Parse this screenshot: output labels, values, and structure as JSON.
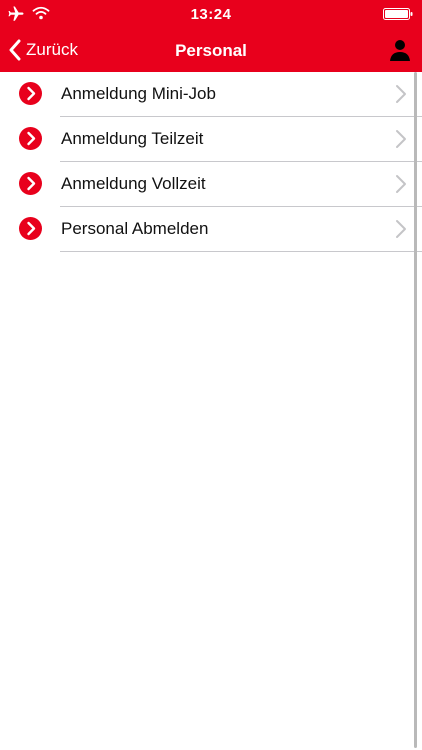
{
  "status_bar": {
    "time": "13:24"
  },
  "nav": {
    "back_label": "Zurück",
    "title": "Personal"
  },
  "items": [
    {
      "label": "Anmeldung Mini-Job"
    },
    {
      "label": "Anmeldung Teilzeit"
    },
    {
      "label": "Anmeldung Vollzeit"
    },
    {
      "label": "Personal Abmelden"
    }
  ],
  "colors": {
    "accent": "#e8001c",
    "separator": "#c8c8cc",
    "disclosure": "#c4c4c7"
  }
}
